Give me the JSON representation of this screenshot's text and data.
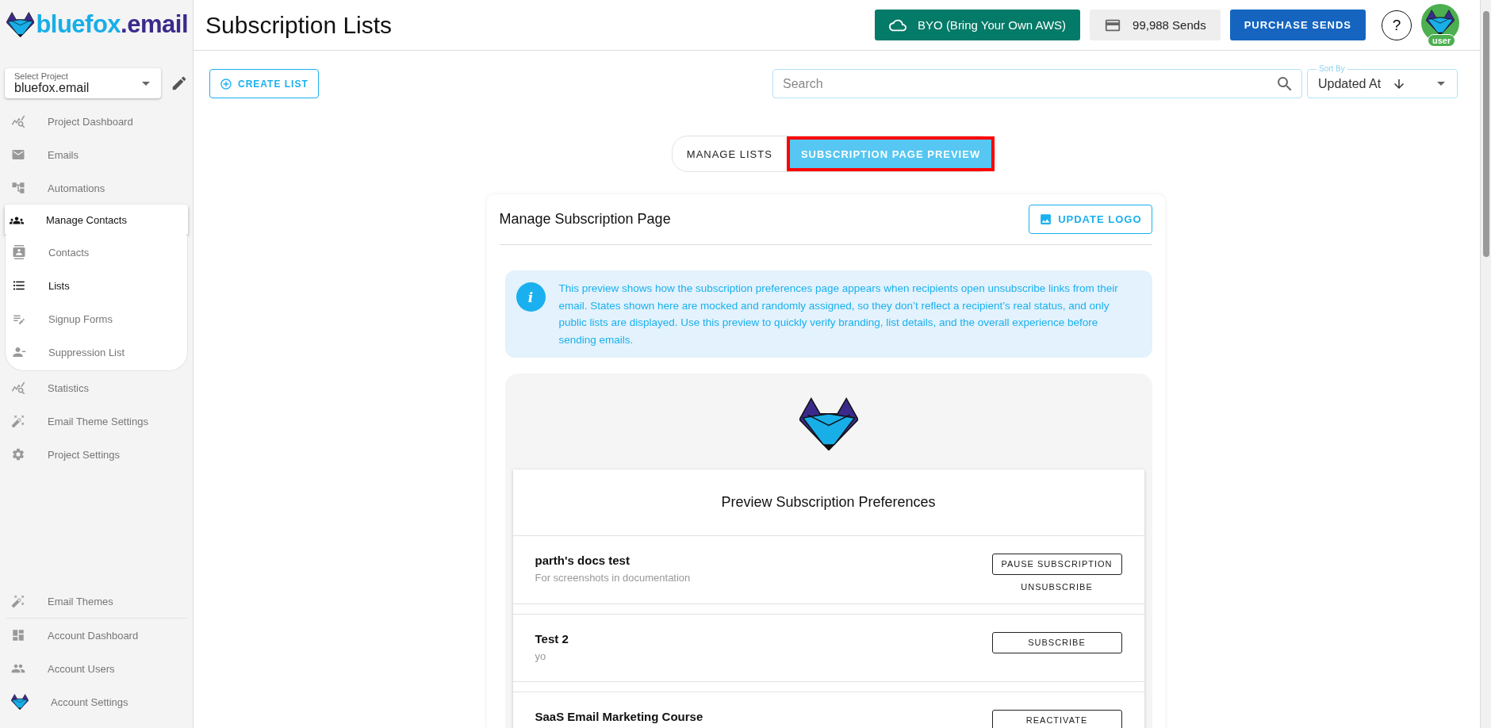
{
  "sidebar": {
    "logo": {
      "name": "bluefox",
      "suffix": ".email"
    },
    "project_select": {
      "label": "Select Project",
      "value": "bluefox.email"
    },
    "items": [
      {
        "label": "Project Dashboard",
        "selected": false
      },
      {
        "label": "Emails",
        "selected": false
      },
      {
        "label": "Automations",
        "selected": false
      },
      {
        "label": "Manage Contacts",
        "selected": true,
        "children": [
          {
            "label": "Contacts",
            "selected": false
          },
          {
            "label": "Lists",
            "selected": true
          },
          {
            "label": "Signup Forms",
            "selected": false
          },
          {
            "label": "Suppression List",
            "selected": false
          }
        ]
      },
      {
        "label": "Statistics",
        "selected": false
      },
      {
        "label": "Email Theme Settings",
        "selected": false
      },
      {
        "label": "Project Settings",
        "selected": false
      }
    ],
    "bottom_items": [
      {
        "label": "Email Themes",
        "selected": false
      },
      {
        "label": "Account Dashboard",
        "selected": false
      },
      {
        "label": "Account Users",
        "selected": false
      },
      {
        "label": "Account Settings",
        "selected": false
      }
    ]
  },
  "header": {
    "title": "Subscription Lists",
    "byo_button": "BYO (Bring Your Own AWS)",
    "sends": "99,988 Sends",
    "purchase_button": "PURCHASE SENDS",
    "help_button": "?",
    "avatar_badge": "user"
  },
  "toolbar": {
    "create_button": "CREATE LIST",
    "search": {
      "placeholder": "Search"
    },
    "sort": {
      "label": "Sort By",
      "value": "Updated At"
    }
  },
  "tabs": [
    {
      "label": "MANAGE LISTS",
      "selected": false,
      "annotated": false
    },
    {
      "label": "SUBSCRIPTION PAGE PREVIEW",
      "selected": true,
      "annotated": true
    }
  ],
  "card": {
    "title": "Manage Subscription Page",
    "update_logo_button": "UPDATE LOGO",
    "info_icon": "i",
    "info": "This preview shows how the subscription preferences page appears when recipients open unsubscribe links from their email. States shown here are mocked and randomly assigned, so they don’t reflect a recipient’s real status, and only public lists are displayed. Use this preview to quickly verify branding, list details, and the overall experience before sending emails.",
    "preview": {
      "title": "Preview Subscription Preferences",
      "lists": [
        {
          "name": "parth's docs test",
          "description": "For screenshots in documentation",
          "actions": [
            {
              "label": "PAUSE SUBSCRIPTION",
              "kind": "outlined"
            },
            {
              "label": "UNSUBSCRIBE",
              "kind": "text"
            }
          ]
        },
        {
          "name": "Test 2",
          "description": "yo",
          "actions": [
            {
              "label": "SUBSCRIBE",
              "kind": "outlined"
            }
          ]
        },
        {
          "name": "SaaS Email Marketing Course",
          "actions": [
            {
              "label": "REACTIVATE",
              "kind": "outlined"
            }
          ]
        }
      ]
    }
  }
}
